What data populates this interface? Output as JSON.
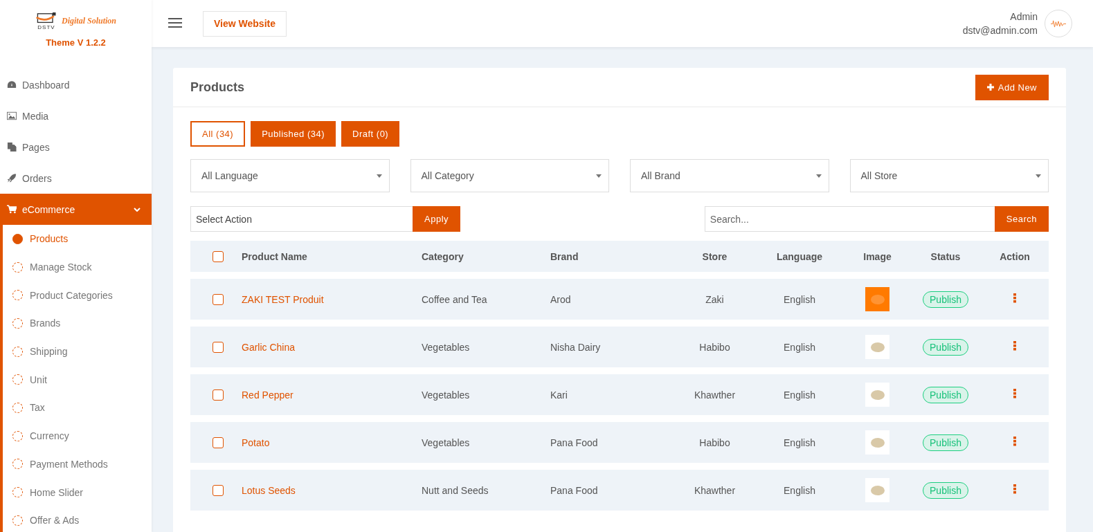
{
  "sidebar": {
    "logo": {
      "text": "Digital Solution",
      "mark": "DSTV"
    },
    "theme_version": "Theme V 1.2.2",
    "items": [
      {
        "label": "Dashboard",
        "selected": false
      },
      {
        "label": "Media",
        "selected": false
      },
      {
        "label": "Pages",
        "selected": false
      },
      {
        "label": "Orders",
        "selected": false
      },
      {
        "label": "eCommerce",
        "selected": true,
        "expanded": true,
        "children": [
          {
            "label": "Products",
            "selected": true
          },
          {
            "label": "Manage Stock",
            "selected": false
          },
          {
            "label": "Product Categories",
            "selected": false
          },
          {
            "label": "Brands",
            "selected": false
          },
          {
            "label": "Shipping",
            "selected": false
          },
          {
            "label": "Unit",
            "selected": false
          },
          {
            "label": "Tax",
            "selected": false
          },
          {
            "label": "Currency",
            "selected": false
          },
          {
            "label": "Payment Methods",
            "selected": false
          },
          {
            "label": "Home Slider",
            "selected": false
          },
          {
            "label": "Offer & Ads",
            "selected": false
          }
        ]
      }
    ]
  },
  "header": {
    "view_website": "View Website",
    "user": {
      "name": "Admin",
      "email": "dstv@admin.com"
    }
  },
  "panel": {
    "title": "Products",
    "add_button": "Add New",
    "tabs": [
      {
        "label": "All (34)",
        "selected": true
      },
      {
        "label": "Published (34)",
        "selected": false
      },
      {
        "label": "Draft (0)",
        "selected": false
      }
    ],
    "filters": [
      "All Language",
      "All Category",
      "All Brand",
      "All Store"
    ],
    "bulk_action": {
      "value": "Select Action",
      "button": "Apply"
    },
    "search": {
      "placeholder": "Search...",
      "button": "Search"
    },
    "table": {
      "header_checked": false,
      "columns": [
        "Product Name",
        "Category",
        "Brand",
        "Store",
        "Language",
        "Image",
        "Status",
        "Action"
      ],
      "rows": [
        {
          "checked": false,
          "name": "ZAKI TEST Produit",
          "category": "Coffee and Tea",
          "brand": "Arod",
          "store": "Zaki",
          "language": "English",
          "status": "Publish"
        },
        {
          "checked": false,
          "name": "Garlic China",
          "category": "Vegetables",
          "brand": "Nisha Dairy",
          "store": "Habibo",
          "language": "English",
          "status": "Publish"
        },
        {
          "checked": false,
          "name": "Red Pepper",
          "category": "Vegetables",
          "brand": "Kari",
          "store": "Khawther",
          "language": "English",
          "status": "Publish"
        },
        {
          "checked": false,
          "name": "Potato",
          "category": "Vegetables",
          "brand": "Pana Food",
          "store": "Habibo",
          "language": "English",
          "status": "Publish"
        },
        {
          "checked": false,
          "name": "Lotus Seeds",
          "category": "Nutt and Seeds",
          "brand": "Pana Food",
          "store": "Khawther",
          "language": "English",
          "status": "Publish"
        }
      ]
    }
  }
}
